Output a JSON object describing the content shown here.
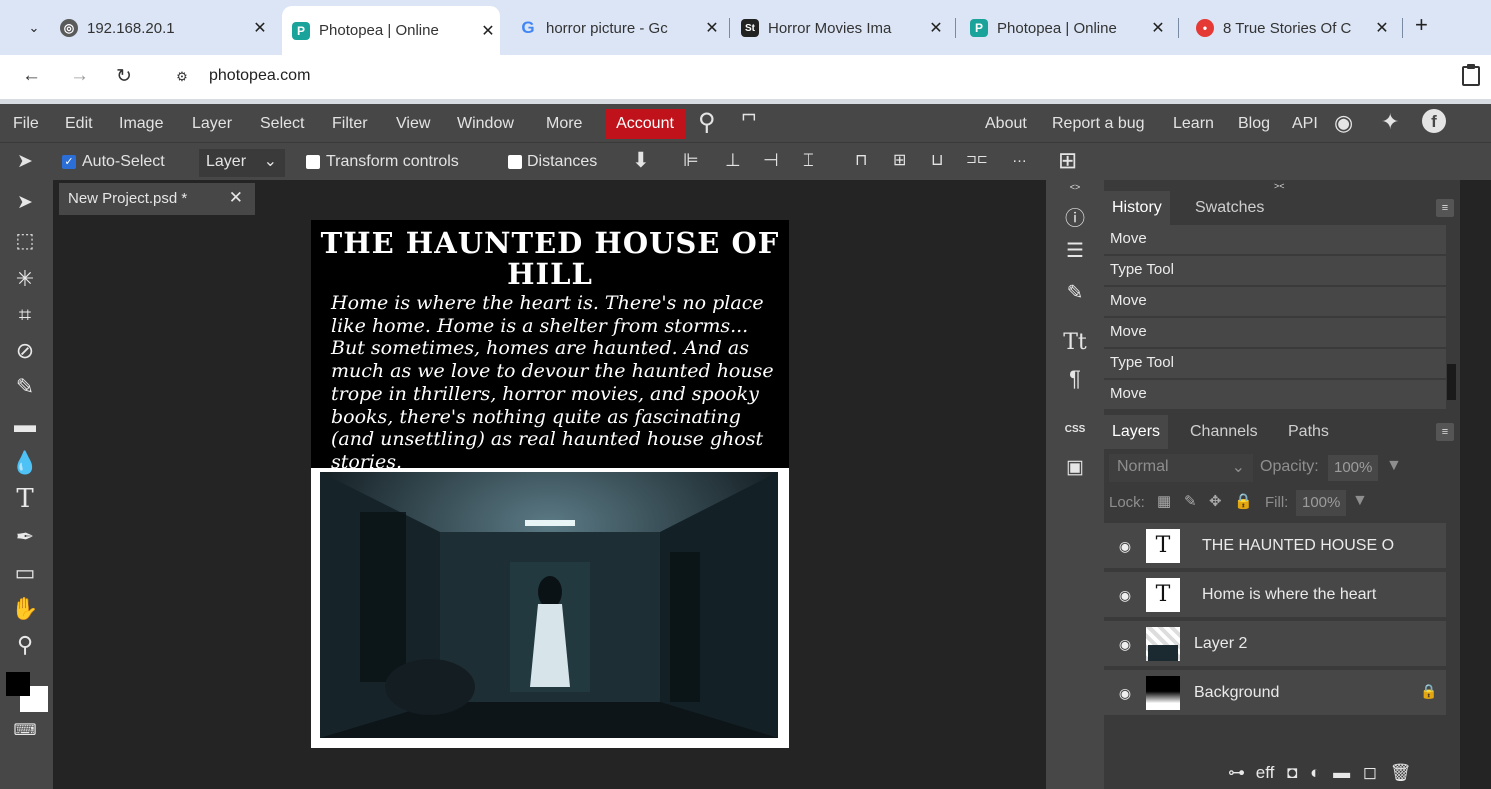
{
  "browser": {
    "tabs": [
      {
        "title": "192.168.20.1",
        "icon": "globe-icon",
        "color": "#5a5a5a"
      },
      {
        "title": "Photopea | Online",
        "icon": "photopea-icon",
        "color": "#1aa39b"
      },
      {
        "title": "horror picture - Gc",
        "icon": "google-icon",
        "color": "#4285f4"
      },
      {
        "title": "Horror Movies Ima",
        "icon": "st-icon",
        "color": "#222222"
      },
      {
        "title": "Photopea | Online",
        "icon": "photopea-icon",
        "color": "#1aa39b"
      },
      {
        "title": "8 True Stories Of C",
        "icon": "site-icon",
        "color": "#e53935"
      }
    ],
    "url": "photopea.com"
  },
  "menu": {
    "items": [
      "File",
      "Edit",
      "Image",
      "Layer",
      "Select",
      "Filter",
      "View",
      "Window",
      "More"
    ],
    "account": "Account",
    "right_items": [
      "About",
      "Report a bug",
      "Learn",
      "Blog",
      "API"
    ]
  },
  "toolbar": {
    "auto_select": "Auto-Select",
    "layer_select": "Layer",
    "transform_controls": "Transform controls",
    "distances": "Distances"
  },
  "document": {
    "tab_title": "New Project.psd *",
    "poster_title": "THE HAUNTED HOUSE OF HILL",
    "poster_body": "Home is where the heart is. There's no place like home. Home is a shelter from storms... But sometimes, homes are haunted. And as much as we love to devour the haunted house trope in thrillers, horror movies, and spooky books, there's nothing quite as fascinating (and unsettling) as real haunted house ghost stories."
  },
  "history_panel": {
    "tabs": [
      "History",
      "Swatches"
    ],
    "rows": [
      "Move",
      "Type Tool",
      "Move",
      "Move",
      "Type Tool",
      "Move"
    ]
  },
  "layers_panel": {
    "tabs": [
      "Layers",
      "Channels",
      "Paths"
    ],
    "blend_mode": "Normal",
    "opacity_label": "Opacity:",
    "opacity_value": "100%",
    "lock_label": "Lock:",
    "fill_label": "Fill:",
    "fill_value": "100%",
    "layers": [
      {
        "name": "THE HAUNTED HOUSE O",
        "type": "text"
      },
      {
        "name": "Home is where the heart",
        "type": "text"
      },
      {
        "name": "Layer 2",
        "type": "image"
      },
      {
        "name": "Background",
        "type": "background"
      }
    ],
    "bottom_icons": [
      "link-icon",
      "effects-icon",
      "mask-icon",
      "adjustment-icon",
      "folder-icon",
      "new-layer-icon",
      "trash-icon"
    ],
    "effects_label": "eff"
  },
  "colors": {
    "account": "#c0121a",
    "panel": "#474747",
    "canvas_bg": "#242424"
  }
}
